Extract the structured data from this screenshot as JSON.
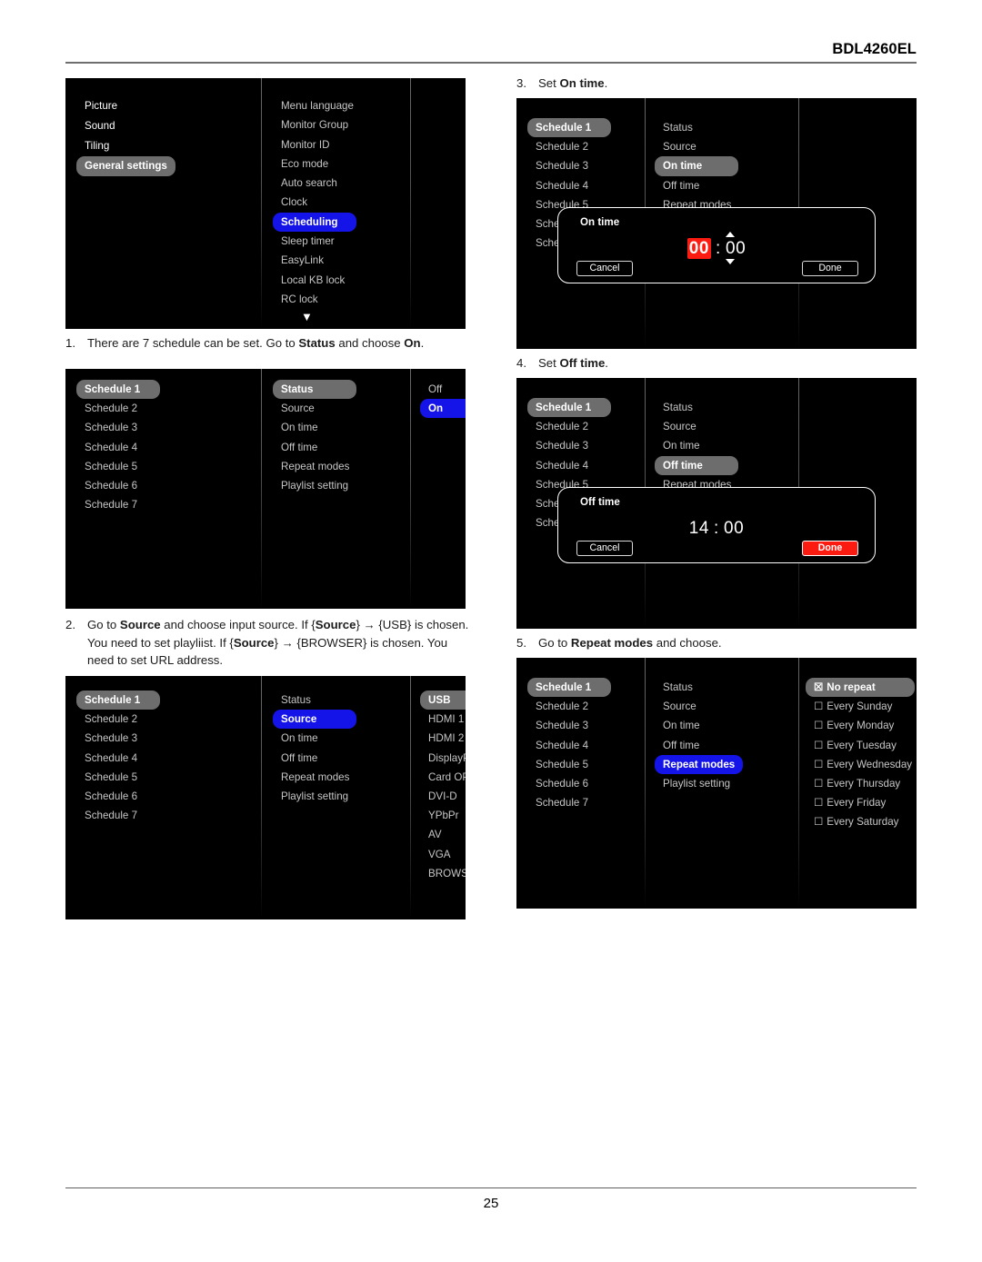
{
  "document": {
    "model_header": "BDL4260EL",
    "page_number": "25"
  },
  "steps": [
    {
      "id": "step-1",
      "number": "1.",
      "parts": [
        {
          "t": "There are 7 schedule can be set. Go to ",
          "b": false
        },
        {
          "t": "Status",
          "b": true
        },
        {
          "t": " and choose ",
          "b": false
        },
        {
          "t": "On",
          "b": true
        },
        {
          "t": ".",
          "b": false
        }
      ]
    },
    {
      "id": "step-2",
      "number": "2.",
      "parts": [
        {
          "t": "Go to ",
          "b": false
        },
        {
          "t": "Source",
          "b": true
        },
        {
          "t": " and choose input source. If {",
          "b": false
        },
        {
          "t": "Source",
          "b": true
        },
        {
          "t": "} → {USB} is chosen. You need to set playliist. If {",
          "b": false
        },
        {
          "t": "Source",
          "b": true
        },
        {
          "t": "} → {BROWSER} is chosen. You need to set URL address.",
          "b": false
        }
      ]
    },
    {
      "id": "step-3",
      "number": "3.",
      "parts": [
        {
          "t": "Set ",
          "b": false
        },
        {
          "t": "On time",
          "b": true
        },
        {
          "t": ".",
          "b": false
        }
      ]
    },
    {
      "id": "step-4",
      "number": "4.",
      "parts": [
        {
          "t": "Set ",
          "b": false
        },
        {
          "t": "Off time",
          "b": true
        },
        {
          "t": ".",
          "b": false
        }
      ]
    },
    {
      "id": "step-5",
      "number": "5.",
      "parts": [
        {
          "t": "Go to ",
          "b": false
        },
        {
          "t": "Repeat modes",
          "b": true
        },
        {
          "t": " and choose.",
          "b": false
        }
      ]
    }
  ],
  "colors": {
    "osd_background": "#000000",
    "highlight_gray": "#6d6d6d",
    "highlight_blue": "#1414e8",
    "accent_red": "#fb1b10",
    "text_dim": "#c6c6c6",
    "text_bright": "#ffffff"
  },
  "panels": {
    "general_settings": {
      "name": "general-settings-menu",
      "col1": [
        {
          "label": "Picture",
          "state": "bright"
        },
        {
          "label": "Sound",
          "state": "bright"
        },
        {
          "label": "Tiling",
          "state": "bright"
        },
        {
          "label": "General settings",
          "state": "sel-gray"
        }
      ],
      "col2": [
        {
          "label": "Menu language",
          "state": "dim"
        },
        {
          "label": "Monitor Group",
          "state": "dim"
        },
        {
          "label": "Monitor ID",
          "state": "dim"
        },
        {
          "label": "Eco mode",
          "state": "dim"
        },
        {
          "label": "Auto search",
          "state": "dim"
        },
        {
          "label": "Clock",
          "state": "dim"
        },
        {
          "label": "Scheduling",
          "state": "sel-blue"
        },
        {
          "label": "Sleep timer",
          "state": "dim"
        },
        {
          "label": "EasyLink",
          "state": "dim"
        },
        {
          "label": "Local KB lock",
          "state": "dim"
        },
        {
          "label": "RC lock",
          "state": "dim"
        }
      ],
      "scroll_down_icon": "▼"
    },
    "status_panel": {
      "name": "schedule-status-menu",
      "col1": [
        {
          "label": "Schedule 1",
          "state": "sel-gray"
        },
        {
          "label": "Schedule 2",
          "state": "dim"
        },
        {
          "label": "Schedule 3",
          "state": "dim"
        },
        {
          "label": "Schedule 4",
          "state": "dim"
        },
        {
          "label": "Schedule 5",
          "state": "dim"
        },
        {
          "label": "Schedule 6",
          "state": "dim"
        },
        {
          "label": "Schedule 7",
          "state": "dim"
        }
      ],
      "col2": [
        {
          "label": "Status",
          "state": "sel-gray"
        },
        {
          "label": "Source",
          "state": "dim"
        },
        {
          "label": "On time",
          "state": "dim"
        },
        {
          "label": "Off time",
          "state": "dim"
        },
        {
          "label": "Repeat modes",
          "state": "dim"
        },
        {
          "label": "Playlist setting",
          "state": "dim"
        }
      ],
      "col3": [
        {
          "label": "Off",
          "state": "dim"
        },
        {
          "label": "On",
          "state": "sel-blue"
        }
      ]
    },
    "source_panel": {
      "name": "schedule-source-menu",
      "col1": [
        {
          "label": "Schedule 1",
          "state": "sel-gray"
        },
        {
          "label": "Schedule 2",
          "state": "dim"
        },
        {
          "label": "Schedule 3",
          "state": "dim"
        },
        {
          "label": "Schedule 4",
          "state": "dim"
        },
        {
          "label": "Schedule 5",
          "state": "dim"
        },
        {
          "label": "Schedule 6",
          "state": "dim"
        },
        {
          "label": "Schedule 7",
          "state": "dim"
        }
      ],
      "col2": [
        {
          "label": "Status",
          "state": "dim"
        },
        {
          "label": "Source",
          "state": "sel-blue"
        },
        {
          "label": "On time",
          "state": "dim"
        },
        {
          "label": "Off time",
          "state": "dim"
        },
        {
          "label": "Repeat modes",
          "state": "dim"
        },
        {
          "label": "Playlist setting",
          "state": "dim"
        }
      ],
      "col3": [
        {
          "label": "USB",
          "state": "sel-gray"
        },
        {
          "label": "HDMI 1",
          "state": "dim"
        },
        {
          "label": "HDMI 2",
          "state": "dim"
        },
        {
          "label": "DisplayPort",
          "state": "dim"
        },
        {
          "label": "Card OPS",
          "state": "dim"
        },
        {
          "label": "DVI-D",
          "state": "dim"
        },
        {
          "label": "YPbPr",
          "state": "dim"
        },
        {
          "label": "AV",
          "state": "dim"
        },
        {
          "label": "VGA",
          "state": "dim"
        },
        {
          "label": "BROWSER",
          "state": "dim"
        }
      ]
    },
    "on_time_panel": {
      "name": "schedule-on-time-menu",
      "col1": [
        {
          "label": "Schedule 1",
          "state": "sel-gray"
        },
        {
          "label": "Schedule 2",
          "state": "dim"
        },
        {
          "label": "Schedule 3",
          "state": "dim"
        },
        {
          "label": "Schedule 4",
          "state": "dim"
        },
        {
          "label": "Schedule 5",
          "state": "dim"
        },
        {
          "label": "Sche",
          "state": "dim"
        },
        {
          "label": "Sche",
          "state": "dim"
        }
      ],
      "col2": [
        {
          "label": "Status",
          "state": "dim"
        },
        {
          "label": "Source",
          "state": "dim"
        },
        {
          "label": "On time",
          "state": "sel-gray"
        },
        {
          "label": "Off time",
          "state": "dim"
        },
        {
          "label": "Repeat modes",
          "state": "dim"
        }
      ],
      "dialog": {
        "title": "On time",
        "hours": "00",
        "separator": ":",
        "minutes": "00",
        "hours_highlighted": true,
        "spin_up_icon": "▲",
        "spin_down_icon": "▼",
        "cancel_label": "Cancel",
        "done_label": "Done",
        "done_accent": false
      }
    },
    "off_time_panel": {
      "name": "schedule-off-time-menu",
      "col1": [
        {
          "label": "Schedule 1",
          "state": "sel-gray"
        },
        {
          "label": "Schedule 2",
          "state": "dim"
        },
        {
          "label": "Schedule 3",
          "state": "dim"
        },
        {
          "label": "Schedule 4",
          "state": "dim"
        },
        {
          "label": "Schedule 5",
          "state": "dim"
        },
        {
          "label": "Sche",
          "state": "dim"
        },
        {
          "label": "Sche",
          "state": "dim"
        }
      ],
      "col2": [
        {
          "label": "Status",
          "state": "dim"
        },
        {
          "label": "Source",
          "state": "dim"
        },
        {
          "label": "On time",
          "state": "dim"
        },
        {
          "label": "Off time",
          "state": "sel-gray"
        },
        {
          "label": "Repeat modes",
          "state": "dim"
        }
      ],
      "dialog": {
        "title": "Off time",
        "hours": "14",
        "separator": ":",
        "minutes": "00",
        "hours_highlighted": false,
        "cancel_label": "Cancel",
        "done_label": "Done",
        "done_accent": true
      }
    },
    "repeat_panel": {
      "name": "schedule-repeat-modes-menu",
      "col1": [
        {
          "label": "Schedule 1",
          "state": "sel-gray"
        },
        {
          "label": "Schedule 2",
          "state": "dim"
        },
        {
          "label": "Schedule 3",
          "state": "dim"
        },
        {
          "label": "Schedule 4",
          "state": "dim"
        },
        {
          "label": "Schedule 5",
          "state": "dim"
        },
        {
          "label": "Schedule 6",
          "state": "dim"
        },
        {
          "label": "Schedule 7",
          "state": "dim"
        }
      ],
      "col2": [
        {
          "label": "Status",
          "state": "dim"
        },
        {
          "label": "Source",
          "state": "dim"
        },
        {
          "label": "On time",
          "state": "dim"
        },
        {
          "label": "Off time",
          "state": "dim"
        },
        {
          "label": "Repeat modes",
          "state": "sel-blue"
        },
        {
          "label": "Playlist setting",
          "state": "dim"
        }
      ],
      "col3": [
        {
          "label": "No repeat",
          "state": "sel-gray",
          "checked": true
        },
        {
          "label": "Every Sunday",
          "state": "dim",
          "checked": false
        },
        {
          "label": "Every Monday",
          "state": "dim",
          "checked": false
        },
        {
          "label": "Every Tuesday",
          "state": "dim",
          "checked": false
        },
        {
          "label": "Every Wednesday",
          "state": "dim",
          "checked": false
        },
        {
          "label": "Every Thursday",
          "state": "dim",
          "checked": false
        },
        {
          "label": "Every Friday",
          "state": "dim",
          "checked": false
        },
        {
          "label": "Every Saturday",
          "state": "dim",
          "checked": false
        }
      ],
      "checkbox_checked_icon": "☒",
      "checkbox_unchecked_icon": "☐"
    }
  }
}
